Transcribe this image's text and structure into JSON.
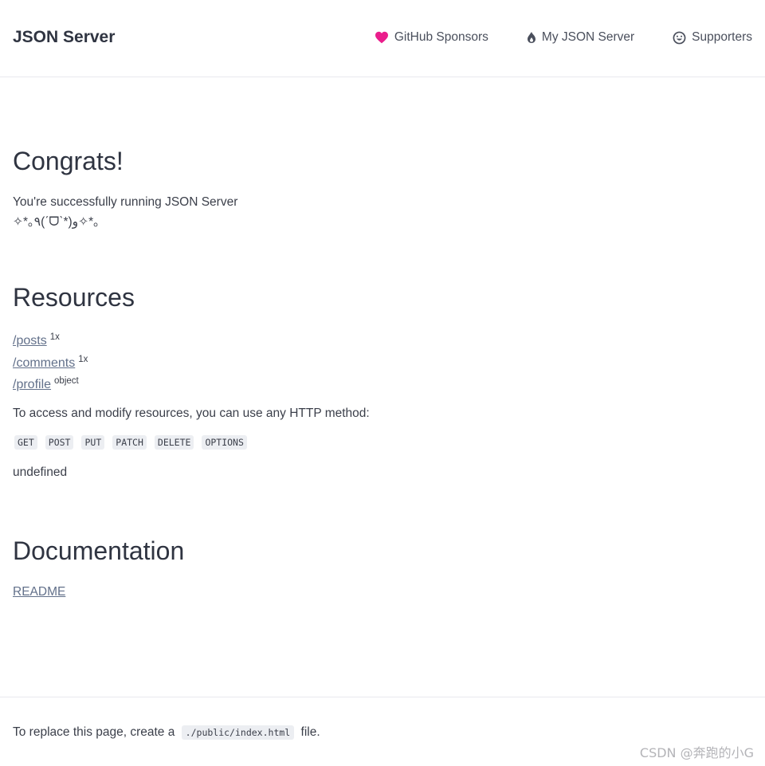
{
  "header": {
    "brand": "JSON Server",
    "nav": [
      {
        "label": "GitHub Sponsors",
        "icon": "heart-icon",
        "icon_color": "#ea1e8c"
      },
      {
        "label": "My JSON Server",
        "icon": "fire-icon"
      },
      {
        "label": "Supporters",
        "icon": "smile-icon"
      }
    ]
  },
  "congrats": {
    "title": "Congrats!",
    "line1": "You're successfully running JSON Server",
    "line2": "✧*｡٩(ˊᗜˋ*)و✧*｡"
  },
  "resources": {
    "title": "Resources",
    "items": [
      {
        "path": "/posts",
        "badge": "1x"
      },
      {
        "path": "/comments",
        "badge": "1x"
      },
      {
        "path": "/profile",
        "badge": "object"
      }
    ],
    "access_text": "To access and modify resources, you can use any HTTP method:",
    "methods": [
      "GET",
      "POST",
      "PUT",
      "PATCH",
      "DELETE",
      "OPTIONS"
    ],
    "undefined_text": "undefined"
  },
  "documentation": {
    "title": "Documentation",
    "link": "README"
  },
  "footer": {
    "prefix": "To replace this page, create a",
    "code": "./public/index.html",
    "suffix": "file."
  },
  "watermark": "CSDN @奔跑的小G",
  "colors": {
    "link": "#62708a",
    "heart": "#ea1e8c",
    "text": "#3b3f4a"
  }
}
